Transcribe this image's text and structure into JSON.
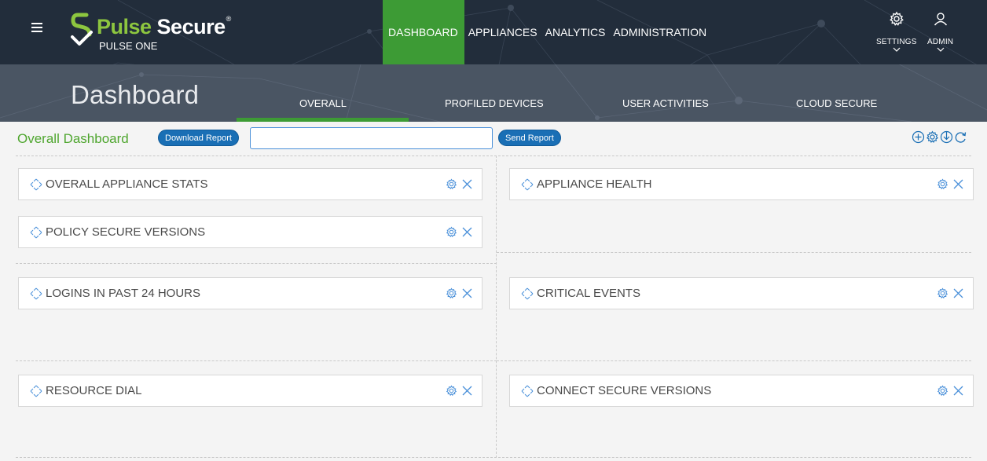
{
  "header": {
    "menu_icon": "hamburger-icon",
    "brand_name": "Pulse Secure",
    "brand_first": "Pulse",
    "brand_second": " Secure",
    "brand_registered": "®",
    "brand_sub": "PULSE ONE",
    "nav": [
      {
        "label": "DASHBOARD",
        "active": true
      },
      {
        "label": "APPLIANCES",
        "active": false
      },
      {
        "label": "ANALYTICS",
        "active": false
      },
      {
        "label": "ADMINISTRATION",
        "active": false
      }
    ],
    "settings_label": "SETTINGS",
    "settings_icon": "gear-icon",
    "admin_label": "ADMIN",
    "admin_icon": "user-icon"
  },
  "subheader": {
    "title": "Dashboard",
    "tabs": [
      {
        "label": "OVERALL",
        "active": true
      },
      {
        "label": "PROFILED DEVICES",
        "active": false
      },
      {
        "label": "USER ACTIVITIES",
        "active": false
      },
      {
        "label": "CLOUD SECURE",
        "active": false
      }
    ]
  },
  "toolbar": {
    "title": "Overall Dashboard",
    "download_label": "Download Report",
    "input_value": "",
    "input_placeholder": "",
    "send_label": "Send Report",
    "icons": [
      "add-icon",
      "gear-icon",
      "download-icon",
      "refresh-icon"
    ]
  },
  "widgets": [
    {
      "title": "OVERALL APPLIANCE STATS"
    },
    {
      "title": "POLICY SECURE VERSIONS"
    },
    {
      "title": "APPLIANCE HEALTH"
    },
    {
      "title": "LOGINS IN PAST 24 HOURS"
    },
    {
      "title": "CRITICAL EVENTS"
    },
    {
      "title": "RESOURCE DIAL"
    },
    {
      "title": "CONNECT SECURE VERSIONS"
    }
  ],
  "colors": {
    "header_bg": "#222d3b",
    "subheader_bg": "#4a5563",
    "accent_green": "#3d9b35",
    "brand_green": "#8dc63f",
    "button_blue": "#1a6fb5"
  }
}
